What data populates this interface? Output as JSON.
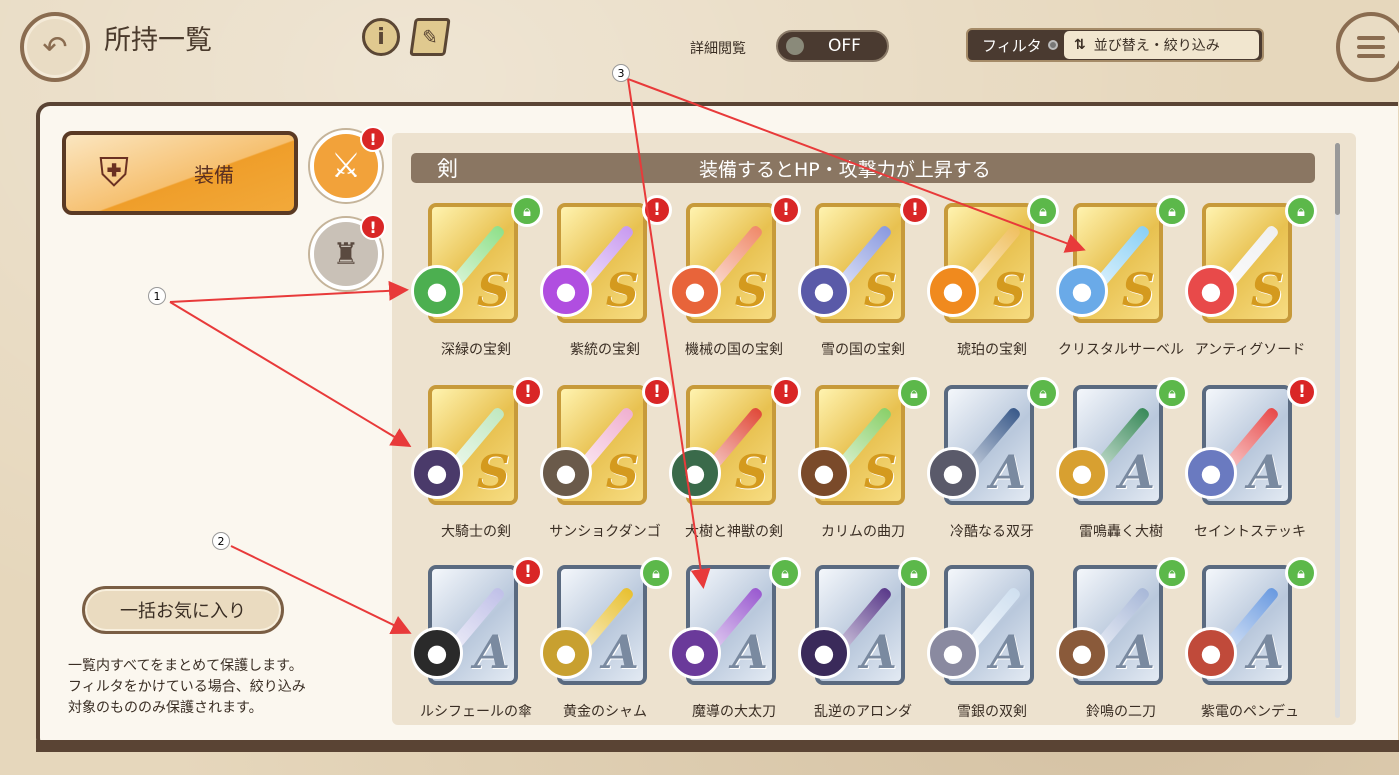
{
  "header": {
    "title": "所持一覧",
    "info_icon": "info-icon",
    "note_icon": "book-icon",
    "detail_view_label": "詳細閲覧",
    "detail_view_toggle": "OFF",
    "filter_label": "フィルタ",
    "sort_filter_label": "並び替え・絞り込み"
  },
  "sidebar": {
    "equip_tab_label": "装備",
    "categories": [
      {
        "name": "sword",
        "icon": "sword-icon",
        "alert": "!"
      },
      {
        "name": "armor",
        "icon": "armor-icon",
        "alert": "!"
      }
    ],
    "favorite_button": "一括お気に入り",
    "favorite_description": "一覧内すべてをまとめて保護します。\nフィルタをかけている場合、絞り込み\n対象のもののみ保護されます。"
  },
  "section": {
    "name": "剣",
    "description": "装備するとHP・攻撃力が上昇する"
  },
  "items": [
    {
      "name": "深緑の宝剣",
      "rank": "S",
      "badge": "lock",
      "color": "#4caf50",
      "blade": "#8fe08a"
    },
    {
      "name": "紫統の宝剣",
      "rank": "S",
      "badge": "warn",
      "color": "#b04ee0",
      "blade": "#c89af0"
    },
    {
      "name": "機械の国の宝剣",
      "rank": "S",
      "badge": "warn",
      "color": "#e8643a",
      "blade": "#f08a6a"
    },
    {
      "name": "雪の国の宝剣",
      "rank": "S",
      "badge": "warn",
      "color": "#5a5aa8",
      "blade": "#8a9ae0"
    },
    {
      "name": "琥珀の宝剣",
      "rank": "S",
      "badge": "lock",
      "color": "#f08a1e",
      "blade": "#f0c060"
    },
    {
      "name": "クリスタルサーベル",
      "rank": "S",
      "badge": "lock",
      "color": "#6aaae8",
      "blade": "#8ad0f5"
    },
    {
      "name": "アンティグソード",
      "rank": "S",
      "badge": "lock",
      "color": "#e84a4a",
      "blade": "#f0f0f0"
    },
    {
      "name": "大騎士の剣",
      "rank": "S",
      "badge": "warn",
      "color": "#4a3a6a",
      "blade": "#c0e8c0"
    },
    {
      "name": "サンショクダンゴ",
      "rank": "S",
      "badge": "warn",
      "color": "#6a5a4a",
      "blade": "#f0b0d0"
    },
    {
      "name": "大樹と神獣の剣",
      "rank": "S",
      "badge": "warn",
      "color": "#3a6a4a",
      "blade": "#e04a3a"
    },
    {
      "name": "カリムの曲刀",
      "rank": "S",
      "badge": "lock",
      "color": "#7a4a2a",
      "blade": "#8ad06a"
    },
    {
      "name": "冷酷なる双牙",
      "rank": "A",
      "badge": "lock",
      "color": "#5a5a6a",
      "blade": "#3a5a8a"
    },
    {
      "name": "雷鳴轟く大樹",
      "rank": "A",
      "badge": "lock",
      "color": "#d8a030",
      "blade": "#3a8a5a"
    },
    {
      "name": "セイントステッキ",
      "rank": "A",
      "badge": "warn",
      "color": "#6a7ac0",
      "blade": "#e84a4a"
    },
    {
      "name": "ルシフェールの傘",
      "rank": "A",
      "badge": "warn",
      "color": "#2a2a2a",
      "blade": "#c0c0e8"
    },
    {
      "name": "黄金のシャム",
      "rank": "A",
      "badge": "lock",
      "color": "#c8a030",
      "blade": "#e8c030"
    },
    {
      "name": "魔導の大太刀",
      "rank": "A",
      "badge": "lock",
      "color": "#6a3a9a",
      "blade": "#9a5ad0"
    },
    {
      "name": "乱逆のアロンダ",
      "rank": "A",
      "badge": "lock",
      "color": "#3a2a5a",
      "blade": "#5a3a8a"
    },
    {
      "name": "雪銀の双剣",
      "rank": "A",
      "badge": "none",
      "color": "#8a8aa0",
      "blade": "#d0e0f0"
    },
    {
      "name": "鈴鳴の二刀",
      "rank": "A",
      "badge": "lock",
      "color": "#8a5a3a",
      "blade": "#a8b8d8"
    },
    {
      "name": "紫電のペンデュ",
      "rank": "A",
      "badge": "lock",
      "color": "#c04a3a",
      "blade": "#6a9ae0"
    }
  ],
  "annotations": [
    "1",
    "2",
    "3"
  ],
  "icons": {
    "back": "back-arrow-icon",
    "menu": "hamburger-menu-icon",
    "lock": "lock-icon",
    "alert": "alert-icon"
  }
}
